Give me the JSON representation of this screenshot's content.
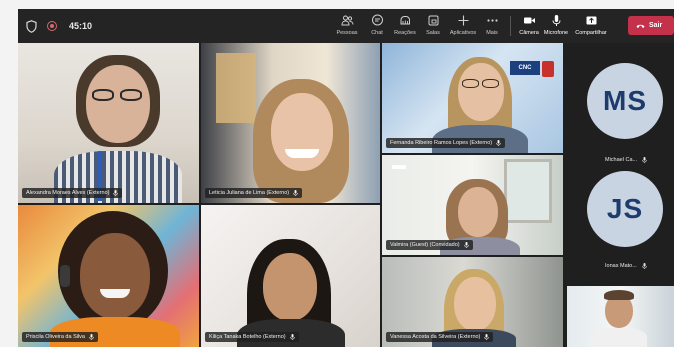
{
  "meeting": {
    "timer": "45:10"
  },
  "toolbar": {
    "items": [
      {
        "label": "Pessoas",
        "icon": "people-icon"
      },
      {
        "label": "Chat",
        "icon": "chat-icon"
      },
      {
        "label": "Reações",
        "icon": "reactions-icon"
      },
      {
        "label": "Salas",
        "icon": "rooms-icon"
      },
      {
        "label": "Aplicativos",
        "icon": "plus-icon"
      },
      {
        "label": "Mais",
        "icon": "more-icon"
      }
    ],
    "av": [
      {
        "label": "Câmera",
        "icon": "camera-icon"
      },
      {
        "label": "Microfone",
        "icon": "microphone-icon"
      },
      {
        "label": "Compartilhar",
        "icon": "share-icon"
      }
    ],
    "leave_label": "Sair"
  },
  "tiles": [
    {
      "name": "Alexandra Moraes Alves (Externo)"
    },
    {
      "name": "Leticia Juliana de Lima (Externo)"
    },
    {
      "name": "Fernanda Ribeiro Ramos Lopes (Externo)"
    },
    {
      "name": "Valmira (Guest) (Convidado)"
    },
    {
      "name": "Priscila Oliveira da Silva"
    },
    {
      "name": "Kiliça Tanaka Botelho (Externo)"
    },
    {
      "name": "Vanessa Acosta da Silveira (Externo)"
    }
  ],
  "sidebar": {
    "participants": [
      {
        "initials": "MS",
        "name": "Michael Ca..."
      },
      {
        "initials": "JS",
        "name": "Ionas Mato..."
      }
    ]
  },
  "colors": {
    "accent_leave": "#c4314b",
    "avatar_bg": "#c9d4e2",
    "avatar_text": "#1d3b6d"
  }
}
